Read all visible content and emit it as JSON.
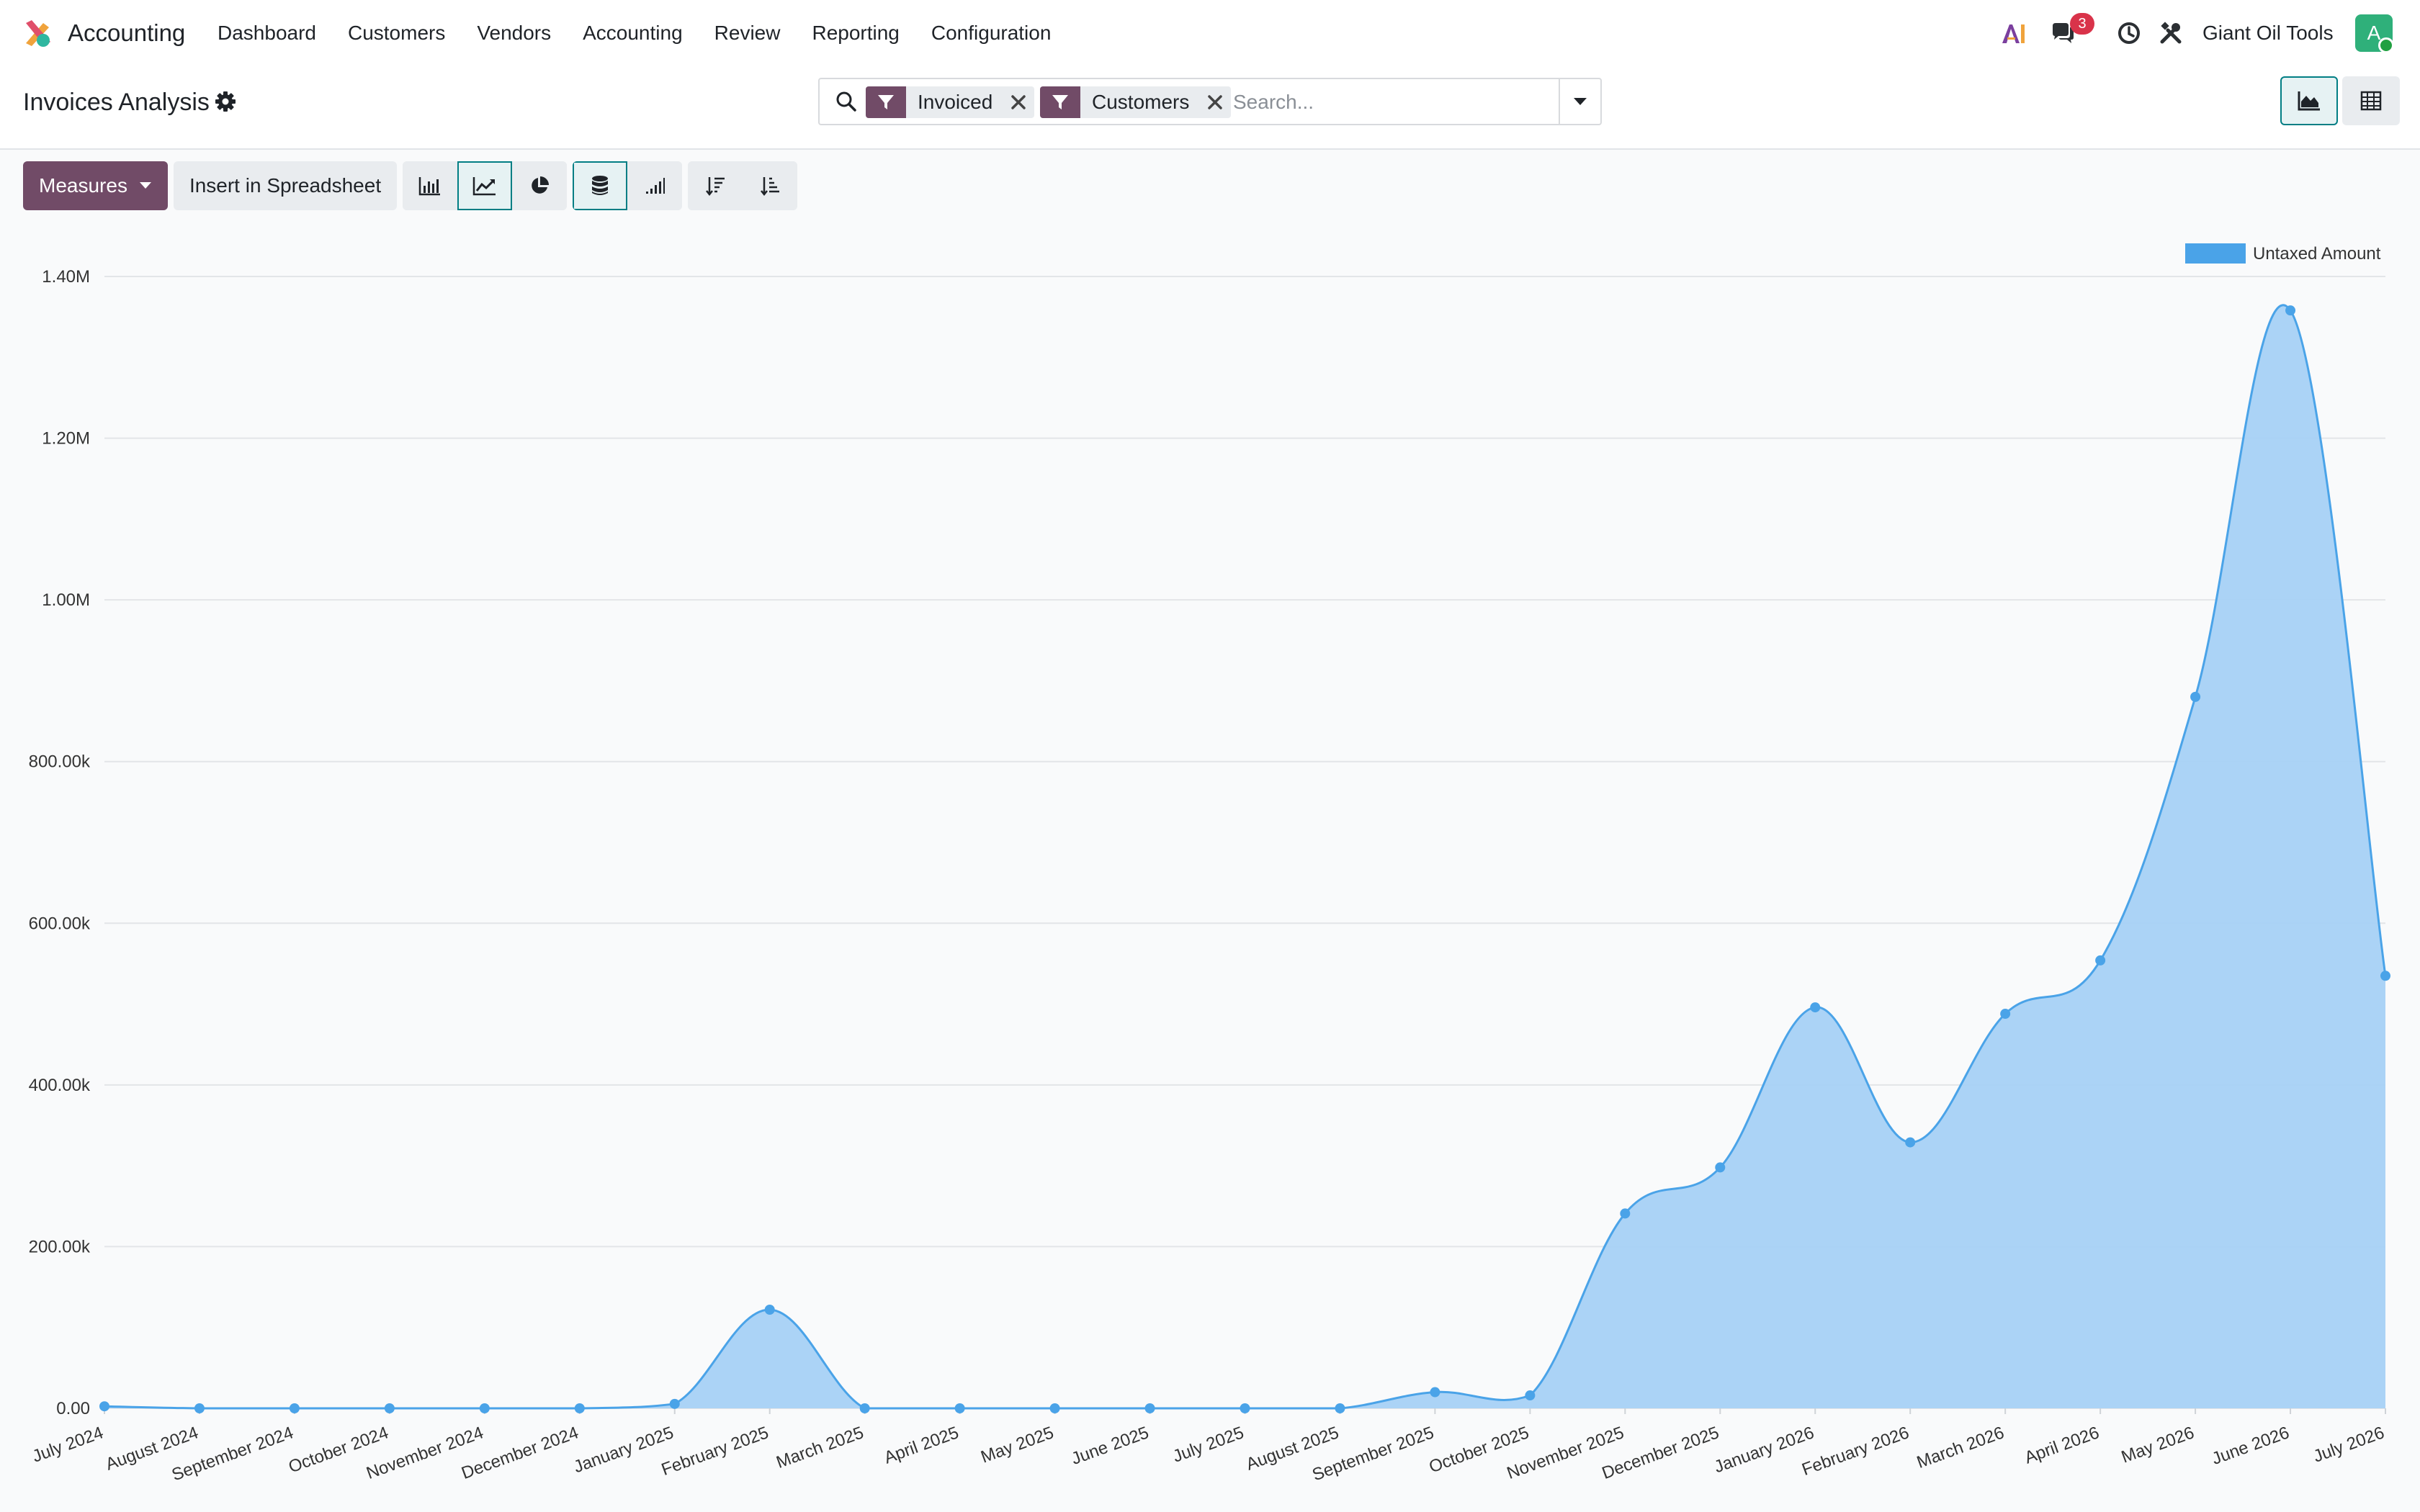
{
  "navbar": {
    "app_name": "Accounting",
    "menu": [
      "Dashboard",
      "Customers",
      "Vendors",
      "Accounting",
      "Review",
      "Reporting",
      "Configuration"
    ],
    "ai_icon": "ai-icon",
    "messages_badge": "3",
    "company": "Giant Oil Tools",
    "avatar_initial": "A"
  },
  "control": {
    "title": "Invoices Analysis",
    "facets": [
      "Invoiced",
      "Customers"
    ],
    "search_placeholder": "Search..."
  },
  "toolbar": {
    "measures_label": "Measures",
    "insert_label": "Insert in Spreadsheet"
  },
  "colors": {
    "brand": "#714b67",
    "accent": "#017e84",
    "series_fill": "#a6d1f5",
    "series_line": "#4aa3e8",
    "badge": "#d9334a"
  },
  "chart_data": {
    "type": "area",
    "categories": [
      "July 2024",
      "August 2024",
      "September 2024",
      "October 2024",
      "November 2024",
      "December 2024",
      "January 2025",
      "February 2025",
      "March 2025",
      "April 2025",
      "May 2025",
      "June 2025",
      "July 2025",
      "August 2025",
      "September 2025",
      "October 2025",
      "November 2025",
      "December 2025",
      "January 2026",
      "February 2026",
      "March 2026",
      "April 2026",
      "May 2026",
      "June 2026",
      "July 2026"
    ],
    "series": [
      {
        "name": "Untaxed Amount",
        "values": [
          2500,
          0,
          0,
          0,
          0,
          0,
          5500,
          122000,
          0,
          0,
          0,
          0,
          0,
          0,
          20000,
          16000,
          241000,
          298000,
          496000,
          329000,
          488000,
          554000,
          880000,
          1358000,
          535000
        ]
      }
    ],
    "yticks": [
      "0.00",
      "200.00k",
      "400.00k",
      "600.00k",
      "800.00k",
      "1.00M",
      "1.20M",
      "1.40M"
    ],
    "ylim": [
      0,
      1400000
    ],
    "grid": true,
    "legend": "top-right"
  }
}
